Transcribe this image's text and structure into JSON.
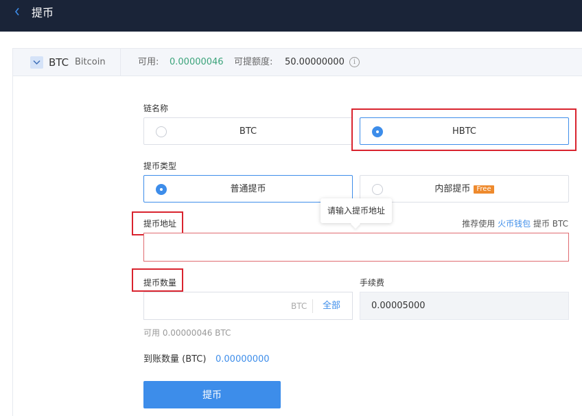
{
  "header": {
    "title": "提币",
    "back_icon": "chevron-left-icon"
  },
  "coin": {
    "symbol": "BTC",
    "name": "Bitcoin",
    "available_label": "可用:",
    "available_value": "0.00000046",
    "quota_label": "可提额度:",
    "quota_value": "50.00000000",
    "info_icon": "info-icon"
  },
  "chain": {
    "label": "链名称",
    "options": [
      {
        "label": "BTC",
        "selected": false
      },
      {
        "label": "HBTC",
        "selected": true
      }
    ]
  },
  "withdraw_type": {
    "label": "提币类型",
    "options": [
      {
        "label": "普通提币",
        "selected": true
      },
      {
        "label": "内部提币",
        "badge": "Free",
        "selected": false
      }
    ]
  },
  "address": {
    "label": "提币地址",
    "tooltip": "请输入提币地址",
    "hint_prefix": "推荐使用",
    "hint_link": "火币钱包",
    "hint_suffix": "提币 BTC",
    "value": ""
  },
  "amount": {
    "label": "提币数量",
    "value": "",
    "unit": "BTC",
    "all_label": "全部",
    "available_hint": "可用 0.00000046 BTC"
  },
  "fee": {
    "label": "手续费",
    "value": "0.00005000"
  },
  "receive": {
    "label": "到账数量 (BTC)",
    "value": "0.00000000"
  },
  "submit_label": "提币",
  "colors": {
    "accent": "#3d8dea",
    "header_bg": "#1a2438",
    "green": "#3aa37a",
    "highlight_red": "#d9232e",
    "badge_orange": "#ee8a2d"
  }
}
